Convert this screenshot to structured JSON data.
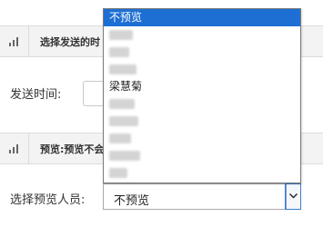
{
  "section1": {
    "title": "选择发送的时",
    "icon": "signal-bars-icon"
  },
  "send_time": {
    "label": "发送时间:"
  },
  "section2": {
    "title": "预览:预览不会",
    "icon": "signal-bars-icon"
  },
  "preview": {
    "label": "选择预览人员:",
    "selected_value": "不预览"
  },
  "dropdown": {
    "options": [
      {
        "label": "不预览",
        "selected": true
      },
      {
        "label": "",
        "redacted": true
      },
      {
        "label": "",
        "redacted": true
      },
      {
        "label": "",
        "redacted": true
      },
      {
        "label": "梁慧菊",
        "selected": false
      },
      {
        "label": "",
        "redacted": true
      },
      {
        "label": "",
        "redacted": true
      },
      {
        "label": "",
        "redacted": true
      },
      {
        "label": "",
        "redacted": true
      },
      {
        "label": "",
        "redacted": true
      }
    ]
  },
  "colors": {
    "selected_option_bg": "#1e6fd3",
    "section_header_bg": "#f3f3f3",
    "focus_border": "#3e7cc9"
  }
}
